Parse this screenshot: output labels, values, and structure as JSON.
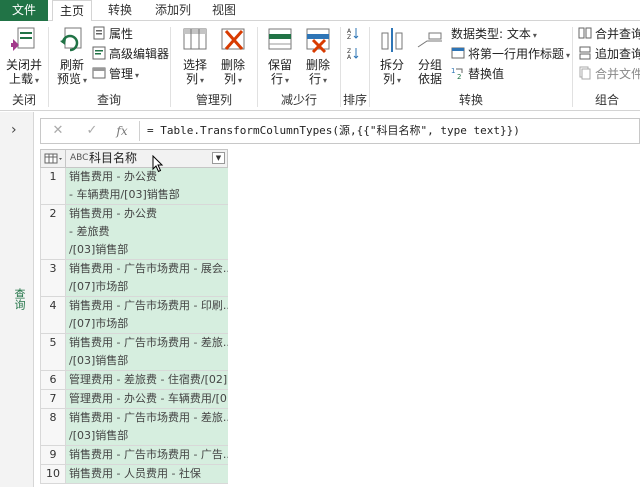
{
  "tabs": [
    "文件",
    "主页",
    "转换",
    "添加列",
    "视图"
  ],
  "ribbon": {
    "close": {
      "btn": "关闭并\n上载",
      "line1": "关闭并",
      "line2": "上载",
      "group": "关闭"
    },
    "query": {
      "refresh1": "刷新",
      "refresh2": "预览",
      "properties": "属性",
      "advanced_editor": "高级编辑器",
      "manage": "管理",
      "group": "查询"
    },
    "manage_cols": {
      "choose1": "选择",
      "choose2": "列",
      "remove1": "删除",
      "remove2": "列",
      "group": "管理列"
    },
    "reduce_rows": {
      "keep1": "保留",
      "keep2": "行",
      "remove1": "删除",
      "remove2": "行",
      "group": "减少行"
    },
    "sort": {
      "group": "排序"
    },
    "transform": {
      "split1": "拆分",
      "split2": "列",
      "groupby1": "分组",
      "groupby2": "依据",
      "datatype": "数据类型: 文本",
      "first_row_header": "将第一行用作标题",
      "replace_values": "替换值",
      "group": "转换"
    },
    "combine": {
      "merge_queries": "合并查询",
      "append_queries": "追加查询",
      "combine_files": "合并文件",
      "group": "组合"
    }
  },
  "query_pane_label": "查询",
  "formula": {
    "text": "= Table.TransformColumnTypes(源,{{\"科目名称\", type text}})",
    "fx": "fx"
  },
  "column": {
    "type_icon": "ABC",
    "name": "科目名称"
  },
  "rows": [
    {
      "n": "1",
      "lines": [
        "销售费用 - 办公费",
        " - 车辆费用/[03]销售部"
      ]
    },
    {
      "n": "2",
      "lines": [
        "销售费用 - 办公费",
        " - 差旅费",
        "/[03]销售部"
      ]
    },
    {
      "n": "3",
      "lines": [
        "销售费用 - 广告市场费用 - 展会...",
        "/[07]市场部"
      ]
    },
    {
      "n": "4",
      "lines": [
        "销售费用 - 广告市场费用 - 印刷...",
        "/[07]市场部"
      ]
    },
    {
      "n": "5",
      "lines": [
        "销售费用 - 广告市场费用 - 差旅...",
        "/[03]销售部"
      ]
    },
    {
      "n": "6",
      "lines": [
        "管理费用 - 差旅费 - 住宿费/[02]..."
      ]
    },
    {
      "n": "7",
      "lines": [
        "管理费用 - 办公费 - 车辆费用/[0..."
      ]
    },
    {
      "n": "8",
      "lines": [
        "销售费用 - 广告市场费用 - 差旅...",
        "/[03]销售部"
      ]
    },
    {
      "n": "9",
      "lines": [
        "销售费用 - 广告市场费用 - 广告..."
      ]
    },
    {
      "n": "10",
      "lines": [
        "销售费用 - 人员费用 - 社保"
      ]
    }
  ],
  "colors": {
    "accent": "#217346",
    "cell_selected": "#d6eedf"
  }
}
